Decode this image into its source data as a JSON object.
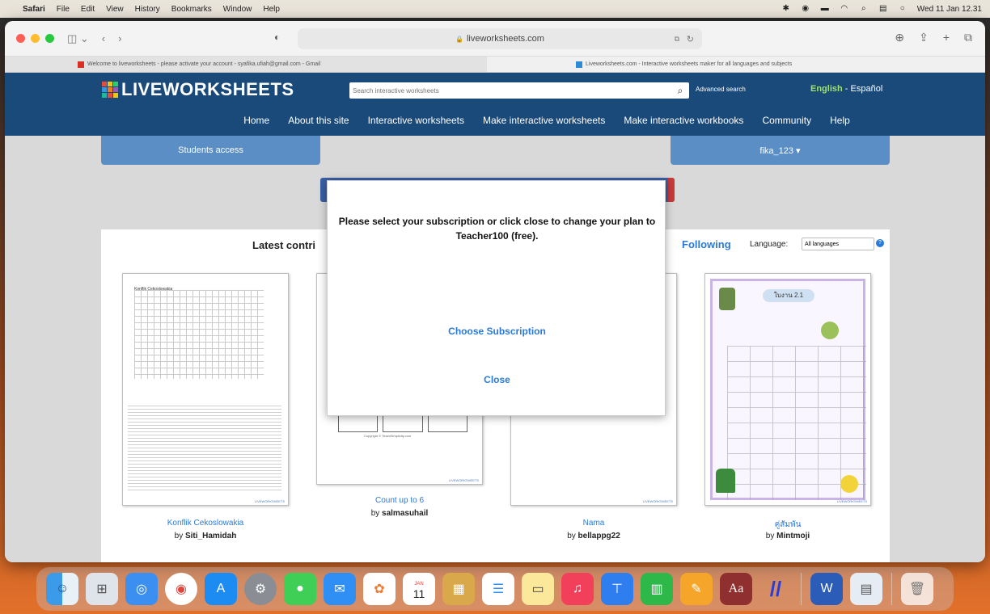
{
  "menubar": {
    "app": "Safari",
    "items": [
      "File",
      "Edit",
      "View",
      "History",
      "Bookmarks",
      "Window",
      "Help"
    ],
    "datetime": "Wed 11 Jan 12.31"
  },
  "browser": {
    "url": "liveworksheets.com",
    "tabs": [
      {
        "title": "Welcome to liveworksheets - please activate your account - syafika.ufiah@gmail.com - Gmail"
      },
      {
        "title": "Liveworksheets.com - Interactive worksheets maker for all languages and subjects"
      }
    ]
  },
  "site": {
    "logo": "LIVEWORKSHEETS",
    "search_placeholder": "Search interactive worksheets",
    "advanced_search": "Advanced search",
    "lang_en": "English",
    "lang_sep": " - ",
    "lang_es": "Español",
    "nav": [
      "Home",
      "About this site",
      "Interactive worksheets",
      "Make interactive worksheets",
      "Make interactive workbooks",
      "Community",
      "Help"
    ],
    "students_access": "Students access",
    "username": "fika_123 ▾"
  },
  "content": {
    "latest_label": "Latest contri",
    "follow_fragment": "k",
    "following": "Following",
    "language_label": "Language:",
    "language_value": "All languages",
    "worksheets": [
      {
        "title": "Konflik Cekoslowakia",
        "by": "by ",
        "author": "Siti_Hamidah"
      },
      {
        "title": "Count up to 6",
        "by": "by ",
        "author": "salmasuhail"
      },
      {
        "title": "Nama",
        "by": "by ",
        "author": "bellappg22"
      },
      {
        "title": "คู่สัมพัน",
        "by": "by ",
        "author": "Mintmoji"
      }
    ],
    "card_mark": "LIVEWORKSHEETS",
    "crossword_title": "Konflik Cekoslowakia",
    "count_copyright": "Copyright © TeachSimplicity.com",
    "thai_sheet_title": "ใบงาน 2.1"
  },
  "modal": {
    "message": "Please select your subscription or click close to change your plan to Teacher100 (free).",
    "choose": "Choose Subscription",
    "close": "Close"
  },
  "dock": {
    "apps": [
      "finder",
      "launchpad",
      "safari",
      "chrome",
      "app-store",
      "system-preferences",
      "messages",
      "mail",
      "photos",
      "calendar",
      "notes-yellow",
      "reminders",
      "notes",
      "music",
      "keynote",
      "numbers",
      "pages",
      "dictionary",
      "slash-app",
      "word",
      "preview",
      "trash"
    ],
    "calendar_day": "11",
    "calendar_month": "JAN",
    "dictionary_glyph": "Aa"
  },
  "colors": {
    "site_header": "#1a4a7a",
    "accent_link": "#2a7ad8",
    "tab_blue": "#5b8ec4",
    "lang_green": "#9fe36a"
  }
}
